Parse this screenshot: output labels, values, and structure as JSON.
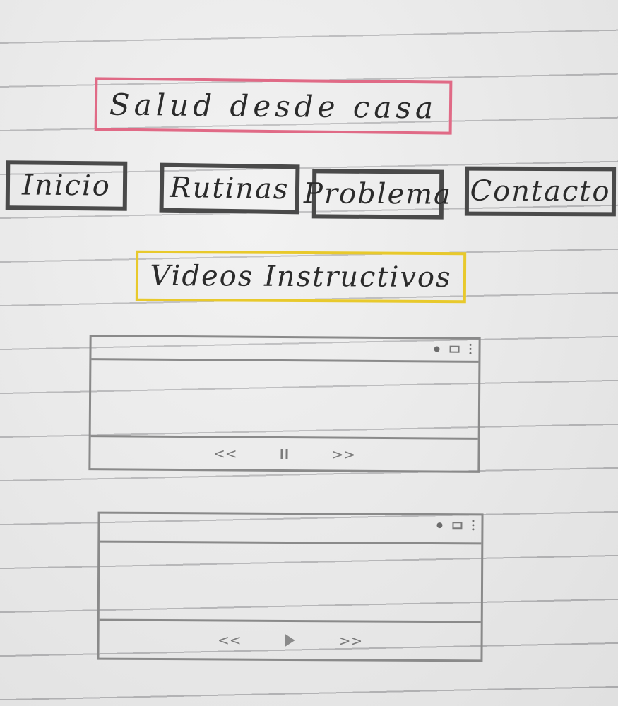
{
  "app": {
    "title": "Salud desde casa"
  },
  "nav": {
    "items": [
      {
        "label": "Inicio"
      },
      {
        "label": "Rutinas"
      },
      {
        "label": "Problema"
      },
      {
        "label": "Contacto"
      }
    ]
  },
  "section": {
    "title": "Videos Instructivos"
  },
  "players": [
    {
      "state": "playing",
      "controls": {
        "rewind": "<<",
        "forward": ">>",
        "center_icon": "pause-icon"
      },
      "toolbar_icons": [
        "dot-icon",
        "square-icon",
        "kebab-icon"
      ]
    },
    {
      "state": "paused",
      "controls": {
        "rewind": "<<",
        "forward": ">>",
        "center_icon": "play-icon"
      },
      "toolbar_icons": [
        "dot-icon",
        "square-icon",
        "kebab-icon"
      ]
    }
  ],
  "colors": {
    "title_border": "#e06a86",
    "nav_border": "#4a4a4a",
    "section_border": "#e8c92c",
    "sketch_line": "#8a8a8a"
  }
}
